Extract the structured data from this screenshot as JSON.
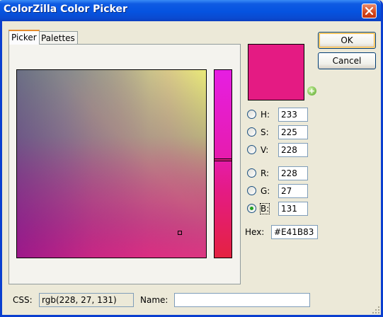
{
  "window": {
    "title": "ColorZilla Color Picker"
  },
  "tabs": [
    {
      "label": "Picker",
      "active": true
    },
    {
      "label": "Palettes",
      "active": false
    }
  ],
  "selected_color": "#E41B83",
  "fields": {
    "h": {
      "label": "H:",
      "value": "233"
    },
    "s": {
      "label": "S:",
      "value": "225"
    },
    "v": {
      "label": "V:",
      "value": "228"
    },
    "r": {
      "label": "R:",
      "value": "228"
    },
    "g": {
      "label": "G:",
      "value": "27"
    },
    "b": {
      "label": "B:",
      "value": "131",
      "checked": true
    },
    "hex": {
      "label": "Hex:",
      "value": "#E41B83"
    }
  },
  "buttons": {
    "ok": "OK",
    "cancel": "Cancel"
  },
  "footer": {
    "css_label": "CSS:",
    "css_value": "rgb(228, 27, 131)",
    "name_label": "Name:",
    "name_value": ""
  }
}
